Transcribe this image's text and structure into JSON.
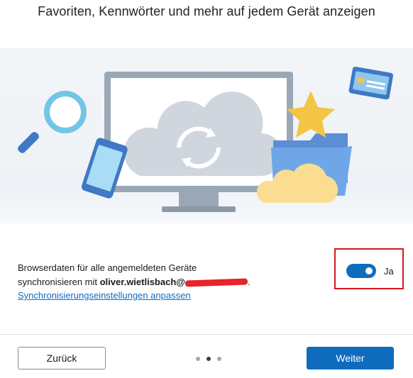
{
  "title": "Favoriten, Kennwörter und mehr auf jedem Gerät anzeigen",
  "sync": {
    "description_line1": "Browserdaten für alle angemeldeten Geräte",
    "description_line2_prefix": "synchronisieren mit ",
    "account": "oliver.wietlisbach@",
    "account_suffix": ".",
    "settings_link": "Synchronisierungseinstellungen anpassen",
    "toggle_label": "Ja",
    "toggle_state": true
  },
  "pager": {
    "total": 3,
    "active_index": 1
  },
  "buttons": {
    "back_label": "Zurück",
    "next_label": "Weiter"
  },
  "colors": {
    "accent": "#0f6cbd",
    "highlight_border": "#d6171e",
    "redaction": "#e8232b"
  },
  "icons": [
    "magnifier-icon",
    "phone-icon",
    "monitor-icon",
    "cloud-sync-icon",
    "star-icon",
    "folder-icon",
    "credit-card-icon",
    "small-cloud-icon"
  ]
}
